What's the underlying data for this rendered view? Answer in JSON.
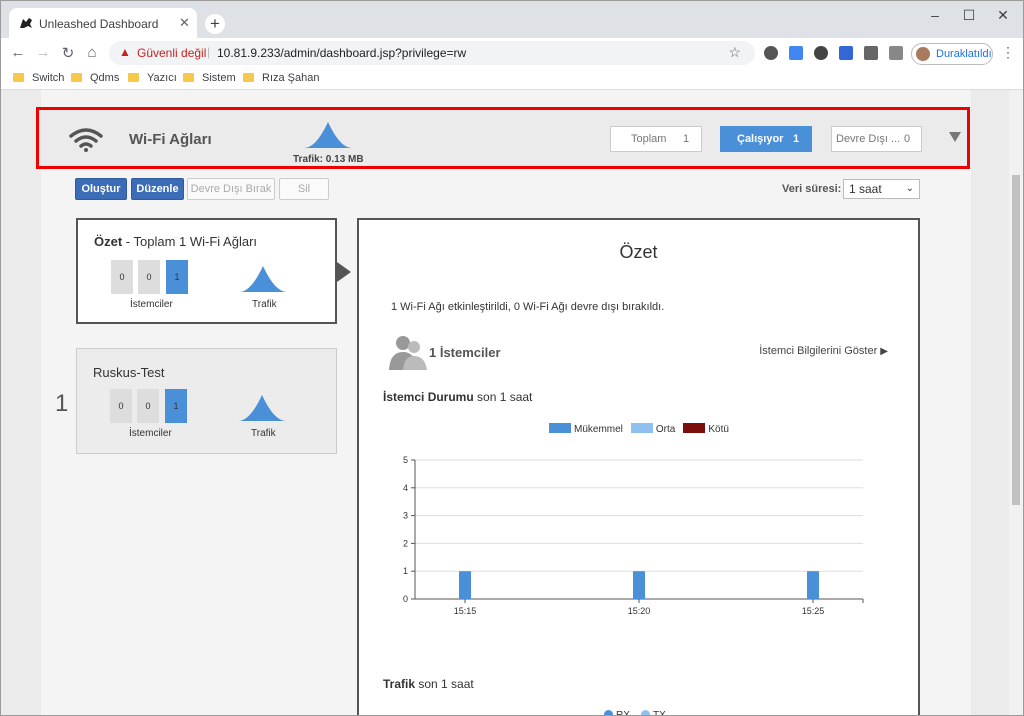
{
  "browser": {
    "tab_title": "Unleashed Dashboard",
    "security_label": "Güvenli değil",
    "url": "10.81.9.233/admin/dashboard.jsp?privilege=rw",
    "profile_label": "Duraklatıldı",
    "bookmarks": [
      "Switch",
      "Qdms",
      "Yazıcı",
      "Sistem",
      "Rıza Şahan"
    ]
  },
  "wifi": {
    "title": "Wi-Fi Ağları",
    "traffic": "Trafik: 0.13 MB",
    "filters": [
      {
        "label": "Toplam",
        "count": "1"
      },
      {
        "label": "Çalışıyor",
        "count": "1"
      },
      {
        "label": "Devre Dışı ...",
        "count": "0"
      }
    ]
  },
  "actions": {
    "create": "Oluştur",
    "edit": "Düzenle",
    "disable": "Devre Dışı Bırak",
    "delete": "Sil",
    "period_label": "Veri süresi:",
    "period_value": "1 saat"
  },
  "summary_card": {
    "title_bold": "Özet",
    "title_rest": " - Toplam 1 Wi-Fi Ağları",
    "stats": [
      "0",
      "0",
      "1"
    ],
    "clients_label": "İstemciler",
    "traffic_label": "Trafik"
  },
  "network_card": {
    "index": "1",
    "title": "Ruskus-Test",
    "stats": [
      "0",
      "0",
      "1"
    ],
    "clients_label": "İstemciler",
    "traffic_label": "Trafik"
  },
  "panel": {
    "title": "Özet",
    "description": "1 Wi-Fi Ağı etkinleştirildi, 0 Wi-Fi Ağı devre dışı bırakıldı.",
    "clients_count": "1 İstemciler",
    "clients_link": "İstemci Bilgilerini Göster",
    "status_title_bold": "İstemci Durumu",
    "status_title_rest": " son 1 saat",
    "traffic_title_bold": "Trafik",
    "traffic_title_rest": " son 1 saat",
    "traffic_legend": [
      "RX",
      "TX"
    ]
  },
  "chart_data": {
    "type": "bar",
    "categories": [
      "15:15",
      "15:20",
      "15:25"
    ],
    "series": [
      {
        "name": "Mükemmel",
        "color": "#4a90d9",
        "values": [
          1,
          1,
          1
        ]
      },
      {
        "name": "Orta",
        "color": "#8ec1f0",
        "values": [
          0,
          0,
          0
        ]
      },
      {
        "name": "Kötü",
        "color": "#7b0d0d",
        "values": [
          0,
          0,
          0
        ]
      }
    ],
    "yticks": [
      "0",
      "1",
      "2",
      "3",
      "4",
      "5"
    ],
    "ylim": [
      0,
      5
    ],
    "grid": true,
    "legend": "top-center"
  }
}
